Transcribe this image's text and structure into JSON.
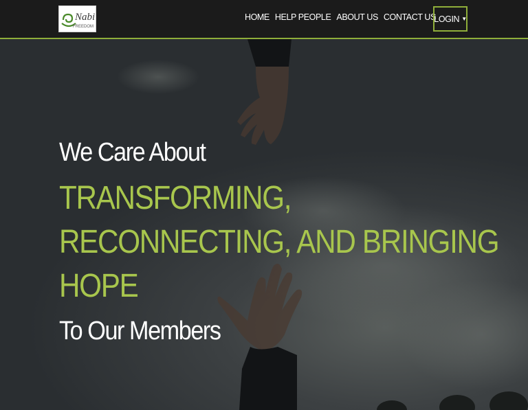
{
  "brand": {
    "logo_word": "Nabi",
    "logo_sub": "FREEDOM"
  },
  "nav": {
    "items": [
      {
        "label": "HOME"
      },
      {
        "label": "HELP PEOPLE"
      },
      {
        "label": "ABOUT US"
      },
      {
        "label": "CONTACT US"
      }
    ],
    "login_label": "LOGIN"
  },
  "hero": {
    "intro": "We Care About",
    "highlight_lines": [
      "TRANSFORMING,",
      "RECONNECTING, AND BRINGING",
      "HOPE"
    ],
    "outro": "To Our Members"
  },
  "colors": {
    "accent": "#a8c64d",
    "navbar": "#1b1b1b",
    "text": "#ffffff"
  }
}
